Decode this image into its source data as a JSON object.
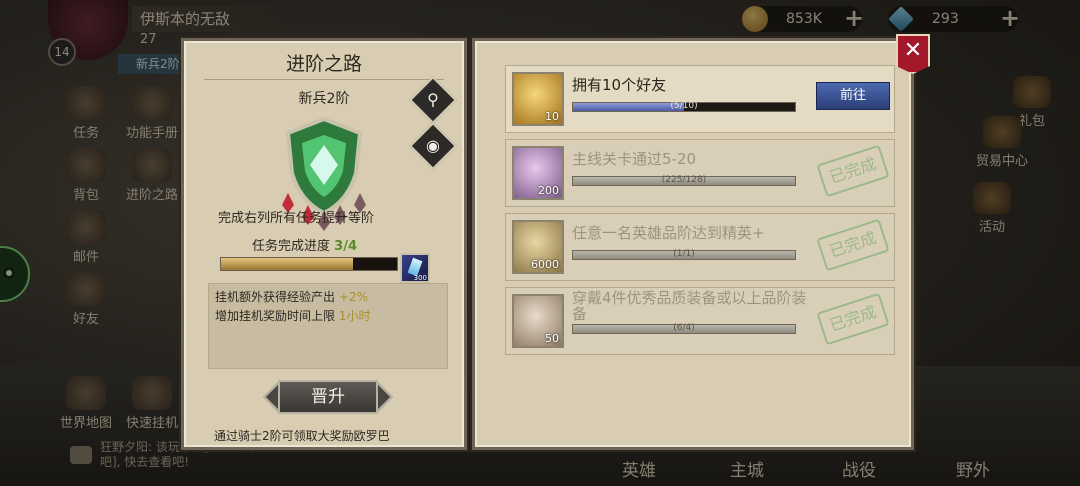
{
  "player": {
    "name": "伊斯本的无敌",
    "level": "14",
    "power": "27",
    "rank_tag": "新兵2阶"
  },
  "resources": {
    "gold": "853K",
    "gems": "293",
    "plus": "+"
  },
  "left_menu": [
    "任务",
    "功能手册",
    "背包",
    "进阶之路",
    "邮件",
    "好友",
    "世界地图",
    "快速挂机"
  ],
  "right_menu": [
    "礼包",
    "贸易中心",
    "活动"
  ],
  "chat": {
    "line1": "狂野夕阳: 该玩家…[云云治募酒",
    "line2": "吧], 快去查看吧!"
  },
  "bottom_nav": [
    "英雄",
    "主城",
    "战役",
    "野外"
  ],
  "advance": {
    "title": "进阶之路",
    "rank": "新兵2阶",
    "description": "完成右列所有任务提升等阶",
    "progress_label": "任务完成进度",
    "progress_value": "3/4",
    "progress_fraction": 0.75,
    "reward_qty": "300",
    "bonus_line1_text": "挂机额外获得经验产出",
    "bonus_line1_value": "+2%",
    "bonus_line2_text": "增加挂机奖励时间上限",
    "bonus_line2_value": "1小时",
    "ascend_label": "晋升",
    "footer": "通过骑士2阶可领取大奖励欧罗巴"
  },
  "close_label": "✕",
  "tasks": [
    {
      "title": "拥有10个好友",
      "progress": "(5/10)",
      "fraction": 0.5,
      "qty": "10",
      "action": "前往",
      "done": false
    },
    {
      "title": "主线关卡通过5-20",
      "progress": "(225/128)",
      "fraction": 1,
      "qty": "200",
      "action": "已完成",
      "done": true
    },
    {
      "title": "任意一名英雄品阶达到精英+",
      "progress": "(1/1)",
      "fraction": 1,
      "qty": "6000",
      "action": "已完成",
      "done": true
    },
    {
      "title": "穿戴4件优秀品质装备或以上品阶装备",
      "progress": "(6/4)",
      "fraction": 1,
      "qty": "50",
      "action": "已完成",
      "done": true
    }
  ]
}
